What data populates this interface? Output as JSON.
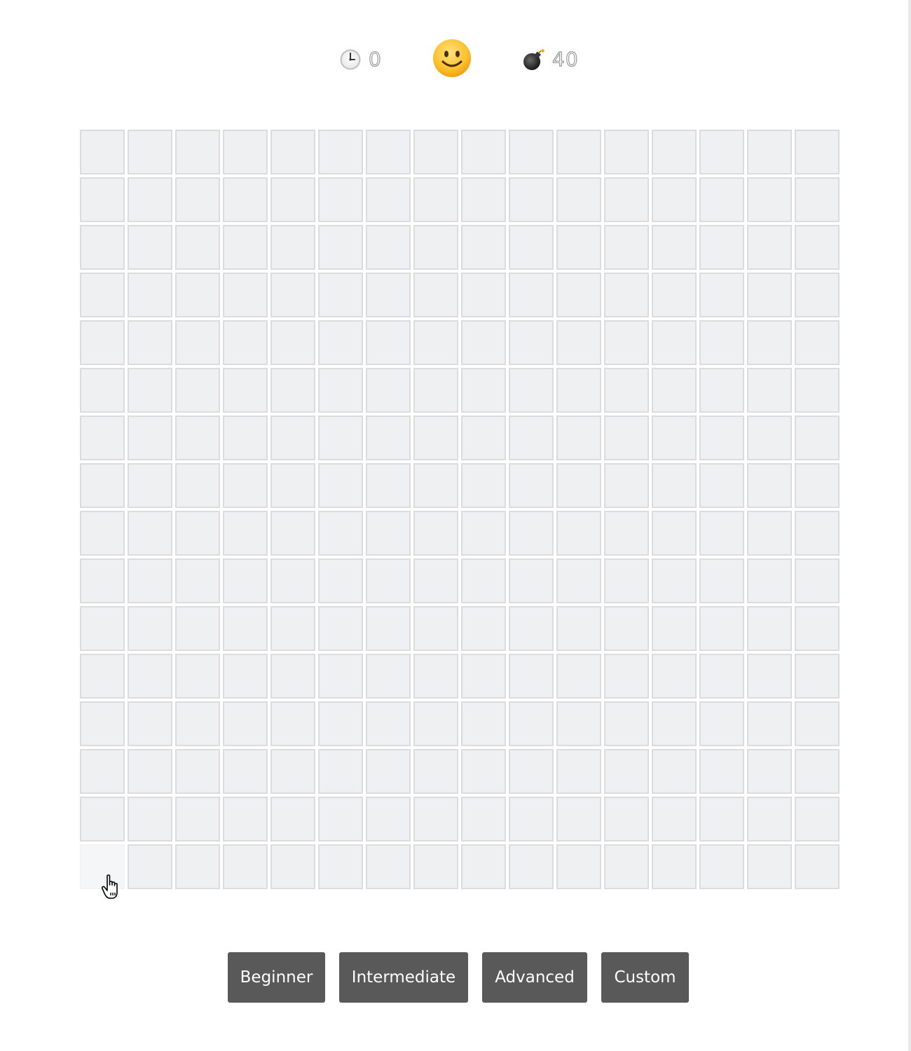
{
  "status": {
    "timer_icon": "clock-icon",
    "timer_value": "0",
    "face_icon": "smiley-face-icon",
    "mine_icon": "bomb-icon",
    "mines_remaining": "40"
  },
  "board": {
    "rows": 16,
    "columns": 16,
    "cell_state": "unrevealed",
    "hovered_cell": {
      "row": 16,
      "column": 1
    }
  },
  "difficulty": {
    "buttons": [
      {
        "label": "Beginner"
      },
      {
        "label": "Intermediate"
      },
      {
        "label": "Advanced"
      },
      {
        "label": "Custom"
      }
    ]
  },
  "colors": {
    "cell_fill": "#eff0f2",
    "cell_border": "#dcdcdc",
    "button_bg": "#595959",
    "button_text": "#ffffff"
  }
}
